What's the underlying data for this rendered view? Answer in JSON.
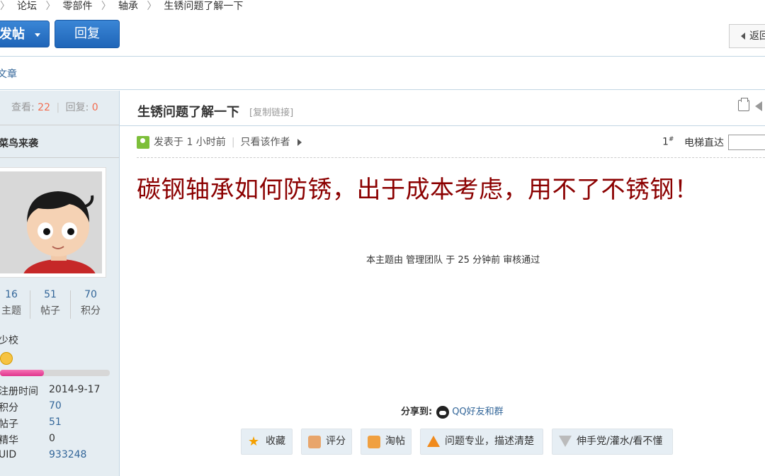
{
  "breadcrumb": {
    "items": [
      "论坛",
      "零部件",
      "轴承",
      "生锈问题了解一下"
    ]
  },
  "toolbar": {
    "post_label": "发帖",
    "reply_label": "回复",
    "back_label": "返回"
  },
  "sub_link": "文章",
  "thread": {
    "views_label": "查看:",
    "views": "22",
    "replies_label": "回复:",
    "replies": "0",
    "title": "生锈问题了解一下",
    "copy_link": "[复制链接]"
  },
  "author": {
    "name": "菜鸟来袭",
    "threads_count": "16",
    "threads_label": "主题",
    "posts_count": "51",
    "posts_label": "帖子",
    "points_count": "70",
    "points_label": "积分",
    "rank": "少校",
    "progress": 0.4,
    "info": [
      {
        "label": "注册时间",
        "value": "2014-9-17"
      },
      {
        "label": "积分",
        "value": "70"
      },
      {
        "label": "帖子",
        "value": "51"
      },
      {
        "label": "精华",
        "value": "0"
      },
      {
        "label": "UID",
        "value": "933248"
      }
    ]
  },
  "post": {
    "posted": "发表于 1 小时前",
    "only_author": "只看该作者",
    "floor": "1",
    "floor_sup": "#",
    "jump_label": "电梯直达",
    "body": "碳钢轴承如何防锈，出于成本考虑，用不了不锈钢！",
    "review_note": "本主题由 管理团队 于 25 分钟前 审核通过"
  },
  "share": {
    "label": "分享到:",
    "qq": "QQ好友和群"
  },
  "actions": [
    {
      "label": "收藏",
      "icon": "star-icon"
    },
    {
      "label": "评分",
      "icon": "thumb-icon"
    },
    {
      "label": "淘帖",
      "icon": "tao-icon"
    },
    {
      "label": "问题专业，描述清楚",
      "icon": "up-arrow-icon"
    },
    {
      "label": "伸手党/灌水/看不懂",
      "icon": "down-arrow-icon"
    }
  ]
}
